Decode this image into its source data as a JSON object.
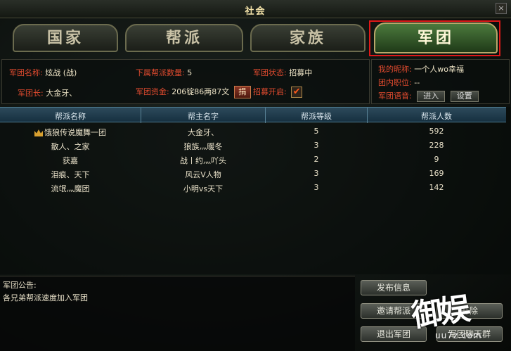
{
  "window": {
    "title": "社会",
    "close_label": "×"
  },
  "tabs": [
    {
      "label": "国家"
    },
    {
      "label": "帮派"
    },
    {
      "label": "家族"
    },
    {
      "label": "军团"
    }
  ],
  "legion_info": {
    "name_label": "军团名称:",
    "name_value": "炫战 (战)",
    "leader_label": "军团长:",
    "leader_value": "大金牙、",
    "sub_count_label": "下属帮派数量:",
    "sub_count_value": "5",
    "funds_label": "军团资金:",
    "funds_value": "206锭86两87文",
    "donate_label": "捐",
    "status_label": "军团状态:",
    "status_value": "招募中",
    "recruit_label": "招募开启:",
    "recruit_checked": "✔"
  },
  "self_info": {
    "nickname_label": "我的昵称:",
    "nickname_value": "一个人wo幸福",
    "position_label": "团内职位:",
    "position_value": "--",
    "voice_label": "军团语音:",
    "enter_label": "进入",
    "settings_label": "设置"
  },
  "table": {
    "headers": [
      "帮派名称",
      "帮主名字",
      "帮派等级",
      "帮派人数"
    ],
    "rows": [
      {
        "name": "饿狼传说魔舞一团",
        "leader": "大金牙、",
        "level": "5",
        "members": "592"
      },
      {
        "name": "散人、之家",
        "leader": "狼族灬暖冬",
        "level": "3",
        "members": "228"
      },
      {
        "name": "获嘉",
        "leader": "战丨约灬吖头",
        "level": "2",
        "members": "9"
      },
      {
        "name": "泪痕、天下",
        "leader": "风云V人物",
        "level": "3",
        "members": "169"
      },
      {
        "name": "流氓灬魔团",
        "leader": "小明vs天下",
        "level": "3",
        "members": "142"
      }
    ]
  },
  "notice": {
    "title": "军团公告:",
    "text": "各兄弟帮派速度加入军团"
  },
  "actions": {
    "publish": "发布信息",
    "invite": "邀请帮派",
    "open": "开除",
    "leave": "退出军团",
    "chat": "军团聊天群"
  },
  "watermark": {
    "logo": "御娱",
    "url": "uu7z.com"
  },
  "colors": {
    "label_red": "#e24b2f",
    "highlight_red": "#e01818",
    "active_tab_green": "#4c7a3d",
    "header_blue": "#2d4a5b"
  }
}
